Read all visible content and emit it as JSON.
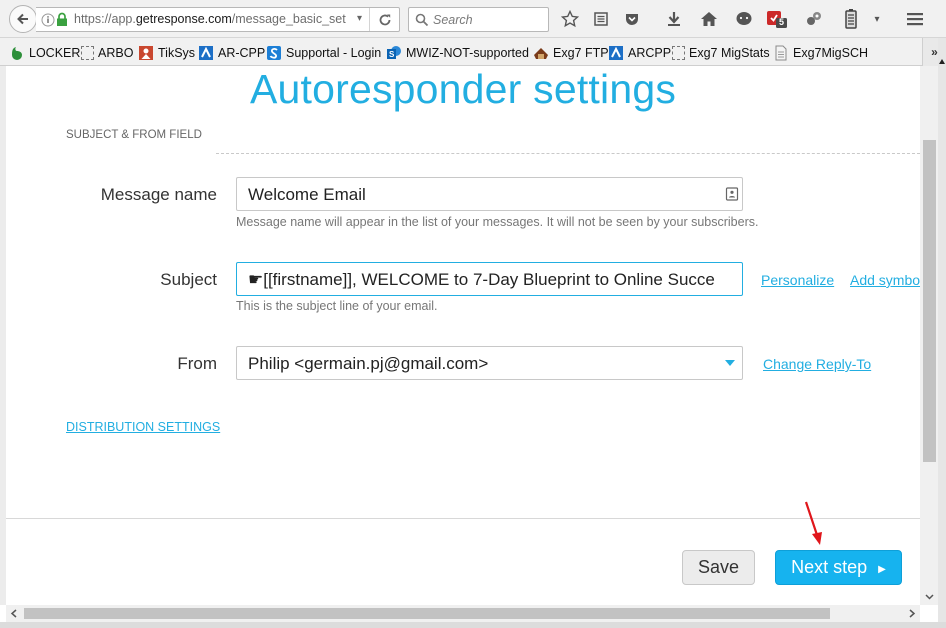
{
  "browser": {
    "url_prefix": "https://app.",
    "url_domain": "getresponse.com",
    "url_suffix": "/message_basic_settir",
    "search_placeholder": "Search",
    "notification_badge": "5"
  },
  "bookmarks": [
    {
      "label": "LOCKER"
    },
    {
      "label": "ARBO"
    },
    {
      "label": "TikSys"
    },
    {
      "label": "AR-CPP"
    },
    {
      "label": "Supportal - Login"
    },
    {
      "label": "MWIZ-NOT-supported"
    },
    {
      "label": "Exg7 FTP"
    },
    {
      "label": "ARCPP"
    },
    {
      "label": "Exg7 MigStats"
    },
    {
      "label": "Exg7MigSCH"
    }
  ],
  "page": {
    "title": "Autoresponder settings",
    "section_label": "SUBJECT & FROM FIELD",
    "message_name": {
      "label": "Message name",
      "value": "Welcome Email",
      "hint": "Message name will appear in the list of your messages. It will not be seen by your subscribers."
    },
    "subject": {
      "label": "Subject",
      "value": "☛[[firstname]], WELCOME to 7-Day Blueprint to Online Succe",
      "hint": "This is the subject line of your email.",
      "personalize_link": "Personalize",
      "add_symbol_link": "Add symbo"
    },
    "from": {
      "label": "From",
      "value": "Philip <germain.pj@gmail.com>",
      "change_reply_link": "Change Reply-To"
    },
    "distribution_link": "DISTRIBUTION SETTINGS",
    "save_label": "Save",
    "next_label": "Next step"
  },
  "colors": {
    "accent": "#22aee1",
    "next_button": "#16b3ef",
    "annotation_arrow": "#e0161b"
  }
}
